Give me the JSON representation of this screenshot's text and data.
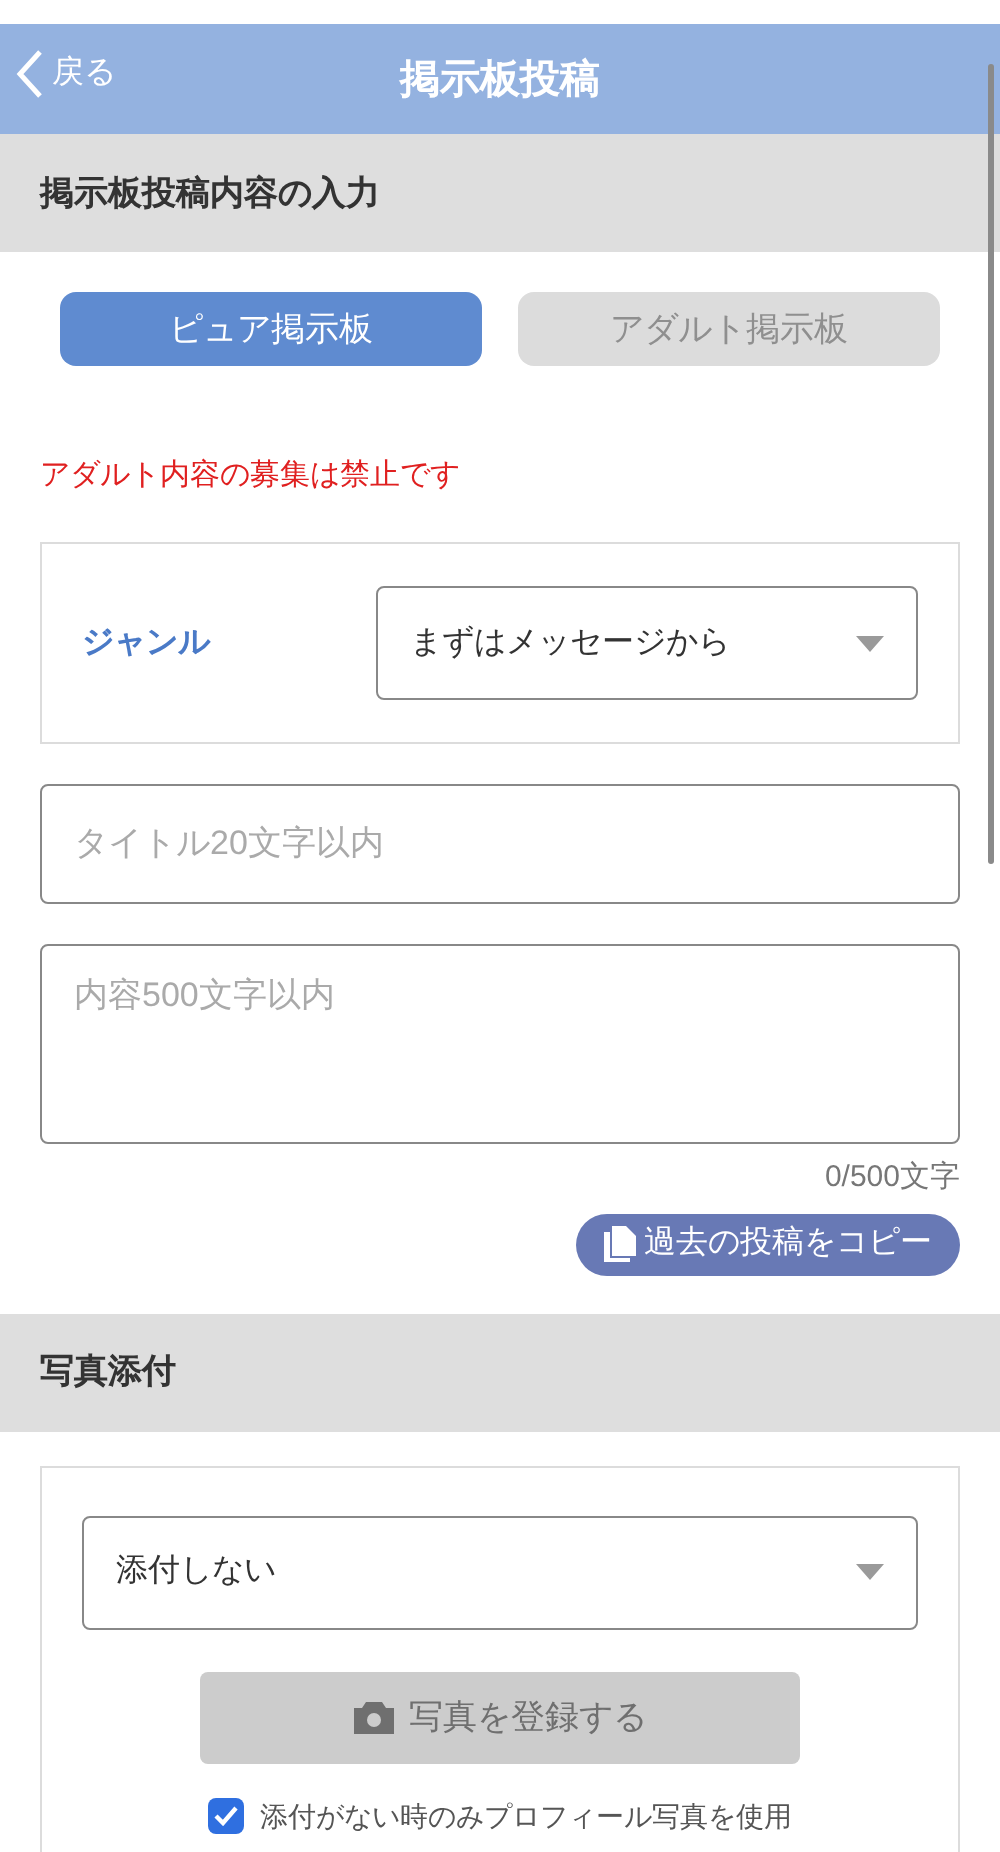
{
  "header": {
    "back": "戻る",
    "title": "掲示板投稿"
  },
  "sections": [
    {
      "title": "掲示板投稿内容の入力"
    },
    {
      "title": "写真添付"
    }
  ],
  "tabs": [
    {
      "label": "ピュア掲示板",
      "selected": true
    },
    {
      "label": "アダルト掲示板",
      "selected": false
    }
  ],
  "warning": "アダルト内容の募集は禁止です",
  "genre": {
    "label": "ジャンル",
    "value": "まずはメッセージから"
  },
  "title_field": {
    "placeholder": "タイトル20文字以内"
  },
  "content_field": {
    "placeholder": "内容500文字以内"
  },
  "counter": "0/500文字",
  "copy_button": "過去の投稿をコピー",
  "photo": {
    "select": "添付しない",
    "register_button": {
      "label": "写真を登録する",
      "disabled": true
    },
    "checkbox": {
      "label": "添付がない時のみプロフィール写真を使用",
      "checked": true
    }
  }
}
